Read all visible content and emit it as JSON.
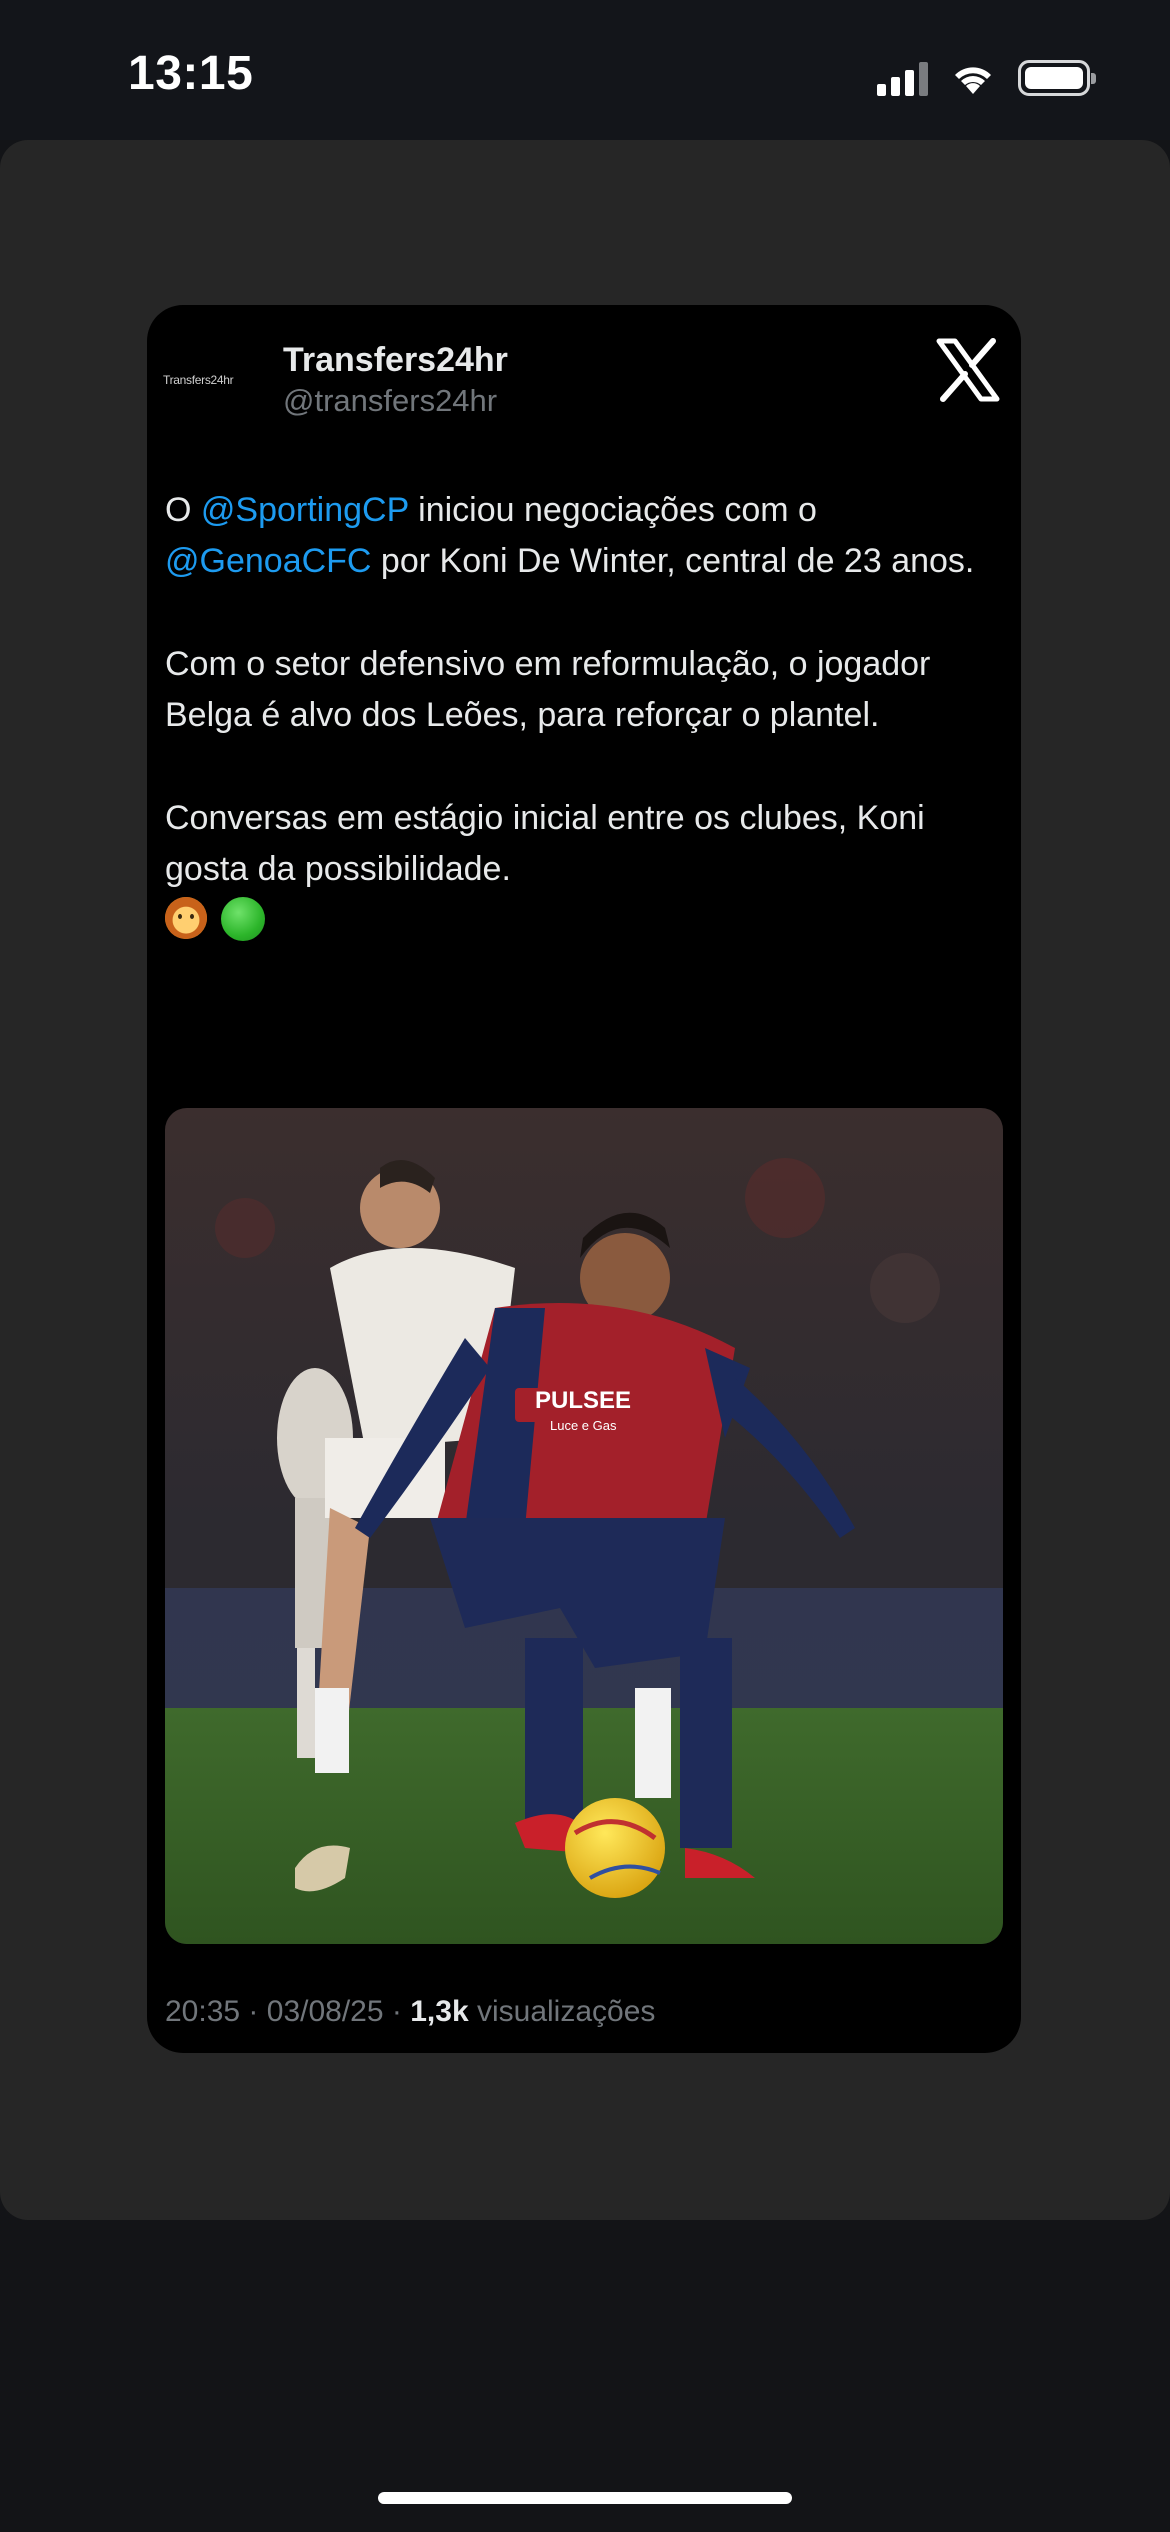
{
  "status_bar": {
    "time": "13:15"
  },
  "tweet": {
    "avatar_text": "Transfers24hr",
    "display_name": "Transfers24hr",
    "handle": "@transfers24hr",
    "paragraph1": {
      "prefix": "O ",
      "mention1": "@SportingCP",
      "middle": " iniciou negociações com o ",
      "mention2": "@GenoaCFC",
      "suffix": " por Koni De Winter, central de 23 anos."
    },
    "paragraph2": "Com o setor defensivo em reformulação, o jogador Belga é alvo dos Leões, para reforçar o plantel.",
    "paragraph3": "Conversas em estágio inicial entre os clubes, Koni gosta da possibilidade.",
    "emojis": [
      "lion-face",
      "green-circle"
    ],
    "photo": {
      "description_icon": "football-players-photo",
      "shirt_text": "PULSEE",
      "shirt_subtext": "Luce e Gas"
    },
    "meta": {
      "time": "20:35",
      "separator": "·",
      "date": "03/08/25",
      "views_count": "1,3k",
      "views_label": "visualizações"
    }
  },
  "colors": {
    "background": "#131417",
    "sheet": "#262626",
    "card": "#000000",
    "mention": "#1d9bf0",
    "muted": "#71767b"
  }
}
